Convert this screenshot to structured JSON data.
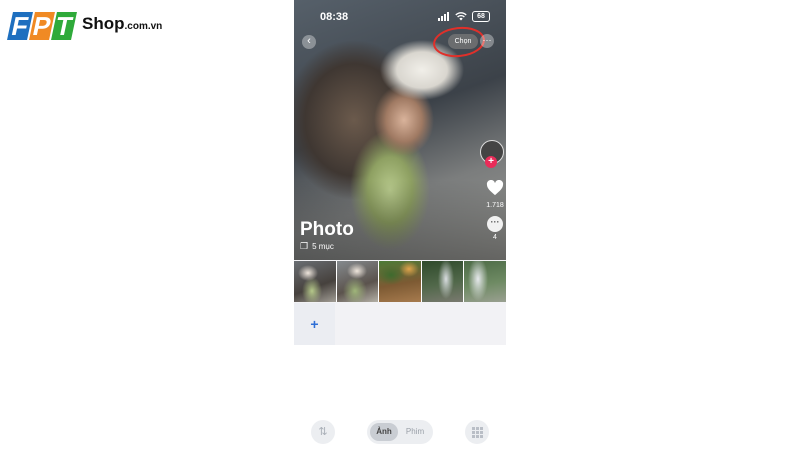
{
  "logo": {
    "letters": [
      "F",
      "P",
      "T"
    ],
    "brand": "Shop",
    "domain": ".com.vn"
  },
  "status_bar": {
    "time": "08:38",
    "battery": "68"
  },
  "top_bar": {
    "back_icon": "chevron-left-icon",
    "select_label": "Chọn",
    "more_icon": "ellipsis-icon"
  },
  "side_actions": {
    "like_count": "1.718",
    "comment_count": "4"
  },
  "album": {
    "title": "Photo",
    "item_count": "5 mục"
  },
  "thumbnails": [
    "photo-1",
    "photo-2",
    "photo-3",
    "photo-4",
    "photo-5"
  ],
  "add_tile": "+",
  "bottom_controls": {
    "segment": [
      "Ảnh",
      "Phim"
    ],
    "selected": "Ảnh"
  },
  "colors": {
    "highlight_ring": "#e0302a",
    "accent_plus": "#ea2c59",
    "add_tile_plus": "#2f6fd6"
  }
}
